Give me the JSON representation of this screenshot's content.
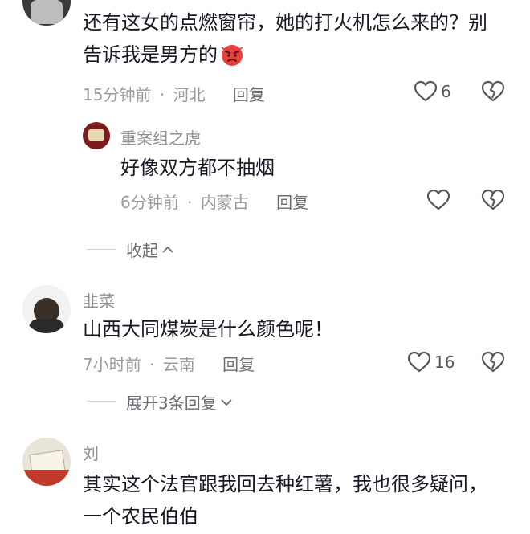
{
  "comments": [
    {
      "text_line1": "还有这女的点燃窗帘，她的打火机怎么来的？别",
      "text_line2": "告诉我是男方的",
      "emoji": "angry-face",
      "time": "15分钟前",
      "location": "河北",
      "reply_label": "回复",
      "likes": "6",
      "replies": [
        {
          "username": "重案组之虎",
          "text": "好像双方都不抽烟",
          "time": "6分钟前",
          "location": "内蒙古",
          "reply_label": "回复"
        }
      ],
      "collapse_label": "收起"
    },
    {
      "username": "韭菜",
      "text": "山西大同煤炭是什么颜色呢！",
      "time": "7小时前",
      "location": "云南",
      "reply_label": "回复",
      "likes": "16",
      "expand_label": "展开3条回复"
    },
    {
      "username": "刘",
      "text_line1": "其实这个法官跟我回去种红薯，我也很多疑问，",
      "text_line2": "一个农民伯伯"
    }
  ],
  "meta_separator": "·",
  "colors": {
    "primary_text": "#161823",
    "secondary_text": "#9a9ba0",
    "icon": "#56575c"
  }
}
